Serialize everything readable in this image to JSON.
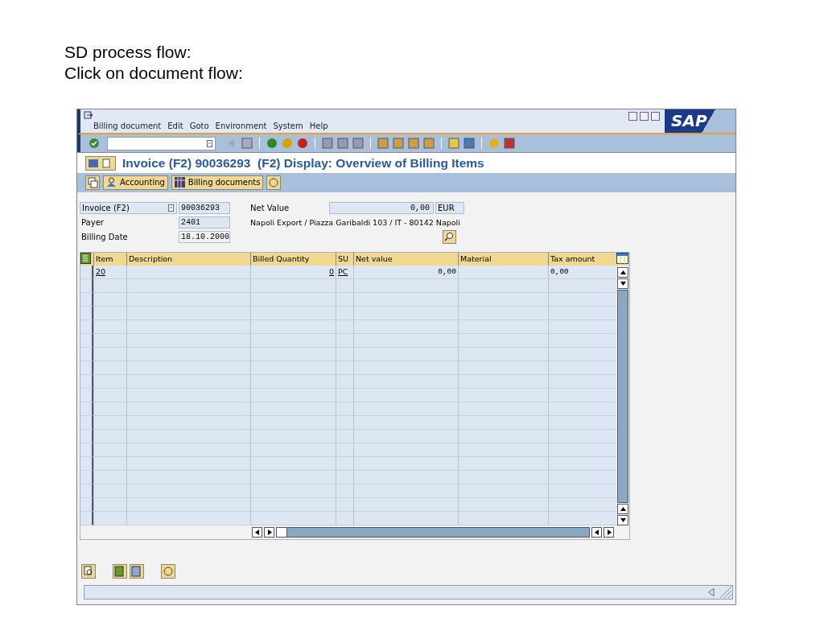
{
  "slide": {
    "heading_lines": [
      "SD process flow:",
      "Click on document flow:"
    ]
  },
  "window": {
    "menu": [
      "Billing document",
      "Edit",
      "Goto",
      "Environment",
      "System",
      "Help"
    ],
    "logo": "SAP",
    "title": "Invoice (F2) 90036293  (F2) Display: Overview of Billing Items"
  },
  "app_toolbar": {
    "buttons": [
      "Accounting",
      "Billing documents"
    ]
  },
  "header": {
    "doc_type": "Invoice (F2)",
    "doc_number": "90036293",
    "payer_label": "Payer",
    "payer": "2401",
    "date_label": "Billing Date",
    "date": "18.10.2000",
    "net_value_label": "Net Value",
    "net_value": "0,00",
    "currency": "EUR",
    "payer_address": "Napoli Export / Piazza Garibaldi 103 / IT - 80142 Napoli"
  },
  "table": {
    "columns": [
      "Item",
      "Description",
      "Billed Quantity",
      "SU",
      "Net value",
      "Material",
      "Tax amount"
    ],
    "rows": [
      {
        "item": "20",
        "billed_quantity": "0",
        "su": "PC",
        "net_value": "0,00",
        "tax_amount": "0,00"
      }
    ]
  }
}
